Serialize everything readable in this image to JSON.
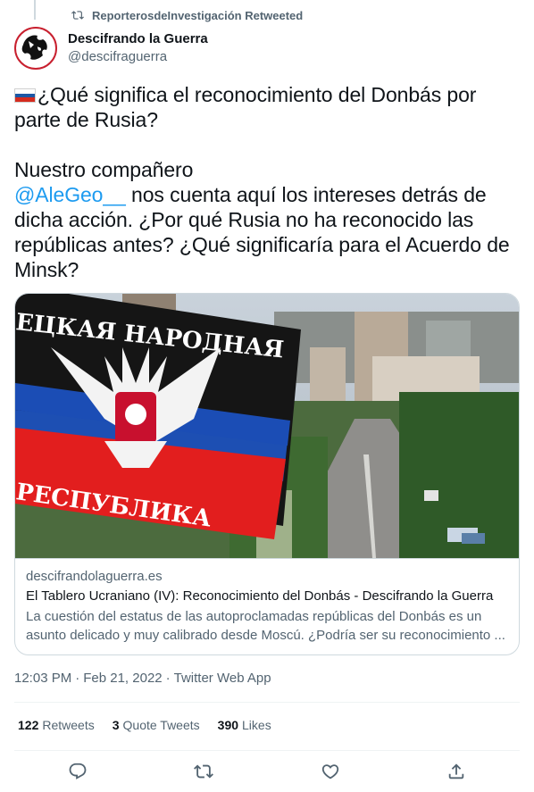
{
  "retweet": {
    "label": "ReporterosdeInvestigación Retweeted",
    "icon": "retweet-icon"
  },
  "author": {
    "display_name": "Descifrando la Guerra",
    "handle": "@descifraguerra",
    "avatar_icon": "globe-logo"
  },
  "tweet": {
    "flag": "Russia flag emoji",
    "line1": "¿Qué significa el reconocimiento del Donbás por parte de Rusia?",
    "line2": "Nuestro compañero",
    "mention": "@AleGeo__",
    "line3": " nos cuenta aquí los intereses detrás de dicha acción. ¿Por qué Rusia no ha reconocido las repúblicas antes? ¿Qué significaría para el Acuerdo de Minsk?"
  },
  "card": {
    "image_text_top": "ЕЦКАЯ НАРОДНАЯ",
    "image_text_bottom": "РЕСПУБЛИКА",
    "domain": "descifrandolaguerra.es",
    "title": "El Tablero Ucraniano (IV): Reconocimiento del Donbás - Descifrando la Guerra",
    "description": "La cuestión del estatus de las autoproclamadas repúblicas del Donbás es un asunto delicado y muy calibrado desde Moscú. ¿Podría ser su reconocimiento ..."
  },
  "meta": {
    "time": "12:03 PM",
    "separator1": "·",
    "date": "Feb 21, 2022",
    "separator2": "·",
    "source": "Twitter Web App"
  },
  "stats": {
    "retweets_count": "122",
    "retweets_label": "Retweets",
    "quotes_count": "3",
    "quotes_label": "Quote Tweets",
    "likes_count": "390",
    "likes_label": "Likes"
  },
  "actions": [
    "reply-icon",
    "retweet-icon",
    "like-icon",
    "share-icon"
  ],
  "colors": {
    "text": "#0f1419",
    "secondary": "#536471",
    "link": "#1d9bf0",
    "border": "#cfd9de"
  }
}
